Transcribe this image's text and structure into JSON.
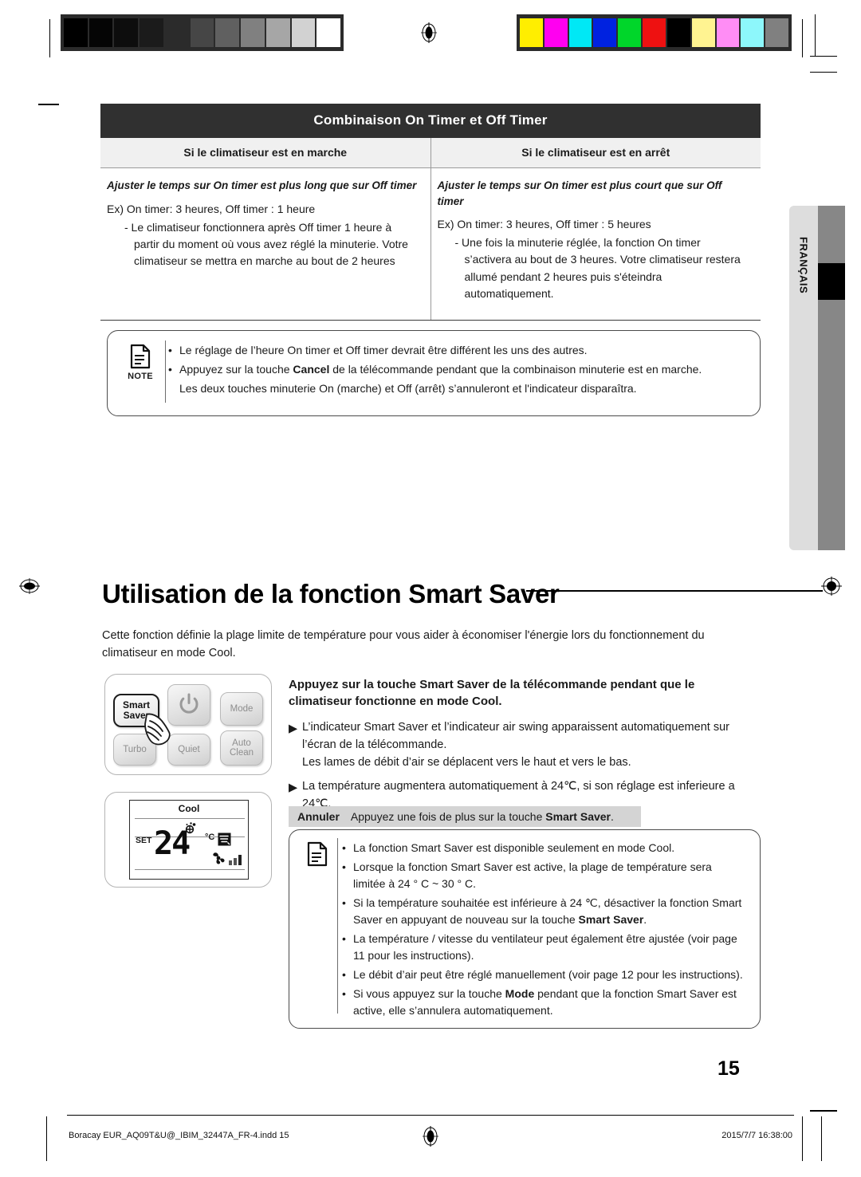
{
  "language_tab": {
    "label": "FRANÇAIS"
  },
  "calibration": {
    "grayscale_label": "grayscale-calibration-bar",
    "grayscale": [
      "#000000",
      "#050505",
      "#0d0d0d",
      "#1b1b1b",
      "#2b2b2b",
      "#464646",
      "#606060",
      "#808080",
      "#a6a6a6",
      "#d2d2d2",
      "#ffffff"
    ],
    "color_label": "color-calibration-bar",
    "colors": [
      "#ffee00",
      "#ff00f0",
      "#00e8f5",
      "#0022e0",
      "#00d62a",
      "#ee1111",
      "#000000",
      "#fff391",
      "#ff8df5",
      "#8df7fb",
      "#808080"
    ]
  },
  "table": {
    "title": "Combinaison On Timer et Off Timer",
    "columns": [
      {
        "header": "Si le climatiseur est en marche"
      },
      {
        "header": "Si le climatiseur est en arrêt"
      }
    ],
    "rows": [
      {
        "lead": "Ajuster le temps sur On timer est plus long que sur Off timer",
        "example": "Ex) On timer:  3 heures, Off timer : 1 heure",
        "detail": "- Le climatiseur fonctionnera après Off timer 1 heure à partir du moment où vous avez réglé la minuterie. Votre climatiseur se mettra en marche au bout de 2 heures"
      },
      {
        "lead": "Ajuster le temps sur On timer est plus court que sur Off timer",
        "example": "Ex) On timer:  3 heures, Off timer : 5 heures",
        "detail": "- Une fois la minuterie réglée, la fonction On timer s’activera au bout de 3 heures. Votre climatiseur restera allumé pendant 2 heures puis s'éteindra automatiquement."
      }
    ]
  },
  "note_top": {
    "word": "NOTE",
    "icon": "document-icon",
    "items": [
      {
        "bullet": "•",
        "text": "Le réglage de l’heure On timer et Off timer devrait être différent les uns des autres."
      },
      {
        "bullet": "•",
        "text_pre": "Appuyez sur la touche ",
        "bold": "Cancel",
        "text_post": " de la télécommande pendant que la combinaison minuterie est en marche."
      }
    ],
    "subline": "Les deux touches minuterie On (marche) et Off (arrêt) s’annuleront et l'indicateur disparaîtra."
  },
  "section": {
    "title": "Utilisation de la fonction Smart Saver",
    "intro": "Cette fonction définie la plage limite de température pour vous aider à économiser l'énergie lors du fonctionnement du climatiseur en mode Cool."
  },
  "remote": {
    "buttons": [
      {
        "name": "smart-saver",
        "line1": "Smart",
        "line2": "Saver",
        "highlight": true
      },
      {
        "name": "power",
        "icon": "power-icon"
      },
      {
        "name": "mode",
        "line1": "Mode"
      },
      {
        "name": "turbo",
        "line1": "Turbo"
      },
      {
        "name": "quiet",
        "line1": "Quiet"
      },
      {
        "name": "auto-clean",
        "line1": "Auto",
        "line2": "Clean"
      }
    ],
    "pointer": "hand-pointer-icon"
  },
  "lcd": {
    "mode": "Cool",
    "set_label": "SET",
    "temperature": "24",
    "unit": "°C",
    "swing_icon": "air-swing-icon",
    "smart_saver_icon": "smart-saver-icon",
    "fan_icon": "fan-icon",
    "fan_level_bars": 3
  },
  "instructions": {
    "heading": "Appuyez sur la touche Smart Saver de la télécommande pendant que le climatiseur fonctionne en mode Cool.",
    "items": [
      {
        "marker": "▶",
        "text": "L’indicateur Smart Saver et l’indicateur air swing apparaissent automatiquement sur l’écran de la télécommande.",
        "extra": "Les lames de débit d’air se déplacent vers le haut et vers le bas."
      },
      {
        "marker": "▶",
        "text": "La température augmentera automatiquement à 24℃, si son réglage est inferieure a 24℃."
      }
    ]
  },
  "cancel_bar": {
    "key": "Annuler",
    "text_pre": "Appuyez une fois de plus sur la touche ",
    "bold": "Smart Saver",
    "text_post": "."
  },
  "note_bottom": {
    "icon": "document-icon",
    "items": [
      {
        "bullet": "•",
        "text": "La fonction Smart Saver est disponible seulement en mode Cool."
      },
      {
        "bullet": "•",
        "text": "Lorsque la fonction Smart Saver est active, la plage de température sera limitée à 24 ° C ~ 30 ° C."
      },
      {
        "bullet": "•",
        "text_pre": "Si la température souhaitée est inférieure à 24 ℃, désactiver la fonction Smart Saver en appuyant de nouveau sur la touche ",
        "bold": "Smart Saver",
        "text_post": "."
      },
      {
        "bullet": "•",
        "text": "La température / vitesse du ventilateur peut également être ajustée (voir page 11 pour les instructions)."
      },
      {
        "bullet": "•",
        "text": "Le débit d’air peut être réglé manuellement (voir page 12 pour les instructions)."
      },
      {
        "bullet": "•",
        "text_pre": "Si vous appuyez sur la touche ",
        "bold": "Mode",
        "text_post": " pendant que la fonction Smart Saver est active, elle s’annulera automatiquement."
      }
    ]
  },
  "page_number": "15",
  "footer": {
    "file": "Boracay EUR_AQ09T&U@_IBIM_32447A_FR-4.indd   15",
    "timestamp": "2015/7/7   16:38:00"
  }
}
